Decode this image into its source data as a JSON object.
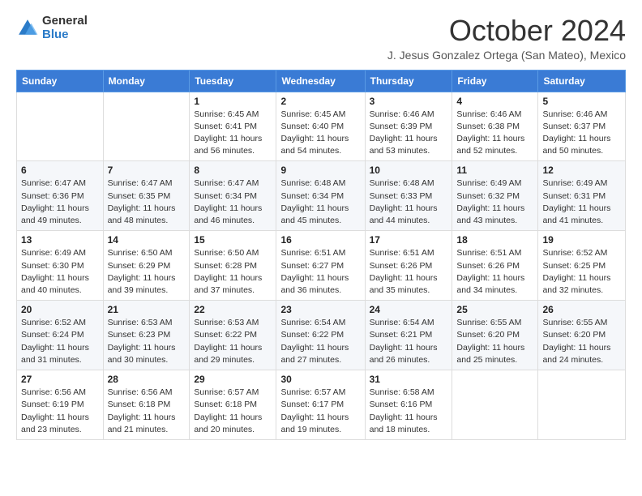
{
  "logo": {
    "general": "General",
    "blue": "Blue"
  },
  "header": {
    "month": "October 2024",
    "subtitle": "J. Jesus Gonzalez Ortega (San Mateo), Mexico"
  },
  "weekdays": [
    "Sunday",
    "Monday",
    "Tuesday",
    "Wednesday",
    "Thursday",
    "Friday",
    "Saturday"
  ],
  "weeks": [
    [
      {
        "day": "",
        "info": ""
      },
      {
        "day": "",
        "info": ""
      },
      {
        "day": "1",
        "info": "Sunrise: 6:45 AM\nSunset: 6:41 PM\nDaylight: 11 hours and 56 minutes."
      },
      {
        "day": "2",
        "info": "Sunrise: 6:45 AM\nSunset: 6:40 PM\nDaylight: 11 hours and 54 minutes."
      },
      {
        "day": "3",
        "info": "Sunrise: 6:46 AM\nSunset: 6:39 PM\nDaylight: 11 hours and 53 minutes."
      },
      {
        "day": "4",
        "info": "Sunrise: 6:46 AM\nSunset: 6:38 PM\nDaylight: 11 hours and 52 minutes."
      },
      {
        "day": "5",
        "info": "Sunrise: 6:46 AM\nSunset: 6:37 PM\nDaylight: 11 hours and 50 minutes."
      }
    ],
    [
      {
        "day": "6",
        "info": "Sunrise: 6:47 AM\nSunset: 6:36 PM\nDaylight: 11 hours and 49 minutes."
      },
      {
        "day": "7",
        "info": "Sunrise: 6:47 AM\nSunset: 6:35 PM\nDaylight: 11 hours and 48 minutes."
      },
      {
        "day": "8",
        "info": "Sunrise: 6:47 AM\nSunset: 6:34 PM\nDaylight: 11 hours and 46 minutes."
      },
      {
        "day": "9",
        "info": "Sunrise: 6:48 AM\nSunset: 6:34 PM\nDaylight: 11 hours and 45 minutes."
      },
      {
        "day": "10",
        "info": "Sunrise: 6:48 AM\nSunset: 6:33 PM\nDaylight: 11 hours and 44 minutes."
      },
      {
        "day": "11",
        "info": "Sunrise: 6:49 AM\nSunset: 6:32 PM\nDaylight: 11 hours and 43 minutes."
      },
      {
        "day": "12",
        "info": "Sunrise: 6:49 AM\nSunset: 6:31 PM\nDaylight: 11 hours and 41 minutes."
      }
    ],
    [
      {
        "day": "13",
        "info": "Sunrise: 6:49 AM\nSunset: 6:30 PM\nDaylight: 11 hours and 40 minutes."
      },
      {
        "day": "14",
        "info": "Sunrise: 6:50 AM\nSunset: 6:29 PM\nDaylight: 11 hours and 39 minutes."
      },
      {
        "day": "15",
        "info": "Sunrise: 6:50 AM\nSunset: 6:28 PM\nDaylight: 11 hours and 37 minutes."
      },
      {
        "day": "16",
        "info": "Sunrise: 6:51 AM\nSunset: 6:27 PM\nDaylight: 11 hours and 36 minutes."
      },
      {
        "day": "17",
        "info": "Sunrise: 6:51 AM\nSunset: 6:26 PM\nDaylight: 11 hours and 35 minutes."
      },
      {
        "day": "18",
        "info": "Sunrise: 6:51 AM\nSunset: 6:26 PM\nDaylight: 11 hours and 34 minutes."
      },
      {
        "day": "19",
        "info": "Sunrise: 6:52 AM\nSunset: 6:25 PM\nDaylight: 11 hours and 32 minutes."
      }
    ],
    [
      {
        "day": "20",
        "info": "Sunrise: 6:52 AM\nSunset: 6:24 PM\nDaylight: 11 hours and 31 minutes."
      },
      {
        "day": "21",
        "info": "Sunrise: 6:53 AM\nSunset: 6:23 PM\nDaylight: 11 hours and 30 minutes."
      },
      {
        "day": "22",
        "info": "Sunrise: 6:53 AM\nSunset: 6:22 PM\nDaylight: 11 hours and 29 minutes."
      },
      {
        "day": "23",
        "info": "Sunrise: 6:54 AM\nSunset: 6:22 PM\nDaylight: 11 hours and 27 minutes."
      },
      {
        "day": "24",
        "info": "Sunrise: 6:54 AM\nSunset: 6:21 PM\nDaylight: 11 hours and 26 minutes."
      },
      {
        "day": "25",
        "info": "Sunrise: 6:55 AM\nSunset: 6:20 PM\nDaylight: 11 hours and 25 minutes."
      },
      {
        "day": "26",
        "info": "Sunrise: 6:55 AM\nSunset: 6:20 PM\nDaylight: 11 hours and 24 minutes."
      }
    ],
    [
      {
        "day": "27",
        "info": "Sunrise: 6:56 AM\nSunset: 6:19 PM\nDaylight: 11 hours and 23 minutes."
      },
      {
        "day": "28",
        "info": "Sunrise: 6:56 AM\nSunset: 6:18 PM\nDaylight: 11 hours and 21 minutes."
      },
      {
        "day": "29",
        "info": "Sunrise: 6:57 AM\nSunset: 6:18 PM\nDaylight: 11 hours and 20 minutes."
      },
      {
        "day": "30",
        "info": "Sunrise: 6:57 AM\nSunset: 6:17 PM\nDaylight: 11 hours and 19 minutes."
      },
      {
        "day": "31",
        "info": "Sunrise: 6:58 AM\nSunset: 6:16 PM\nDaylight: 11 hours and 18 minutes."
      },
      {
        "day": "",
        "info": ""
      },
      {
        "day": "",
        "info": ""
      }
    ]
  ]
}
